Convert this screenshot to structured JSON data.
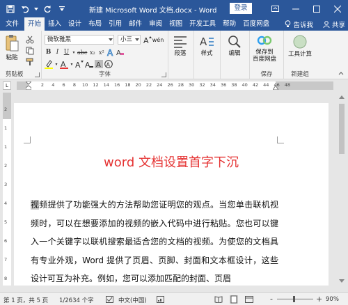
{
  "window": {
    "title": "新建 Microsoft Word 文档.docx - Word",
    "login_label": "登录"
  },
  "tabs": [
    "文件",
    "开始",
    "插入",
    "设计",
    "布局",
    "引用",
    "邮件",
    "审阅",
    "视图",
    "开发工具",
    "帮助",
    "百度网盘"
  ],
  "tab_active": "开始",
  "tab_right": {
    "tell_me": "告诉我",
    "share": "共享"
  },
  "ribbon": {
    "clipboard": {
      "paste_label": "粘贴",
      "group_label": "剪贴板"
    },
    "font": {
      "font_name": "微软雅黑",
      "font_size": "小三",
      "size_unit": "wén",
      "group_label": "字体"
    },
    "paragraph": {
      "label": "段落"
    },
    "styles": {
      "label": "样式"
    },
    "editing": {
      "label": "编辑"
    },
    "save": {
      "label_line1": "保存到",
      "label_line2": "百度网盘",
      "group_label": "保存"
    },
    "newgroup": {
      "label": "工具计算",
      "group_label": "新建组"
    }
  },
  "ruler_ticks": [
    "2",
    "4",
    "6",
    "8",
    "10",
    "12",
    "14",
    "16",
    "18",
    "20",
    "22",
    "24",
    "26",
    "28",
    "30",
    "32",
    "34",
    "36",
    "38",
    "40",
    "42",
    "44",
    "46",
    "48"
  ],
  "vruler_ticks": [
    "2",
    "1",
    "1",
    "2",
    "3",
    "4",
    "5",
    "6",
    "7",
    "8"
  ],
  "document": {
    "title": "word 文档设置首字下沉",
    "drop_char": "视",
    "body": "频提供了功能强大的方法帮助您证明您的观点。当您单击联机视频时，可以在想要添加的视频的嵌入代码中进行粘贴。您也可以键入一个关键字以联机搜索最适合您的文档的视频。为使您的文档具有专业外观，Word 提供了页眉、页脚、封面和文本框设计，这些设计可互为补充。例如，您可以添加匹配的封面、页眉"
  },
  "statusbar": {
    "page": "第 1 页，共 5 页",
    "words": "1/2634 个字",
    "language": "中文(中国)",
    "zoom": "90%",
    "zoom_minus": "-",
    "zoom_plus": "+"
  },
  "colors": {
    "brand": "#2b579a",
    "title_red": "#e53333",
    "ribbon_bg": "#f3f3f3"
  }
}
